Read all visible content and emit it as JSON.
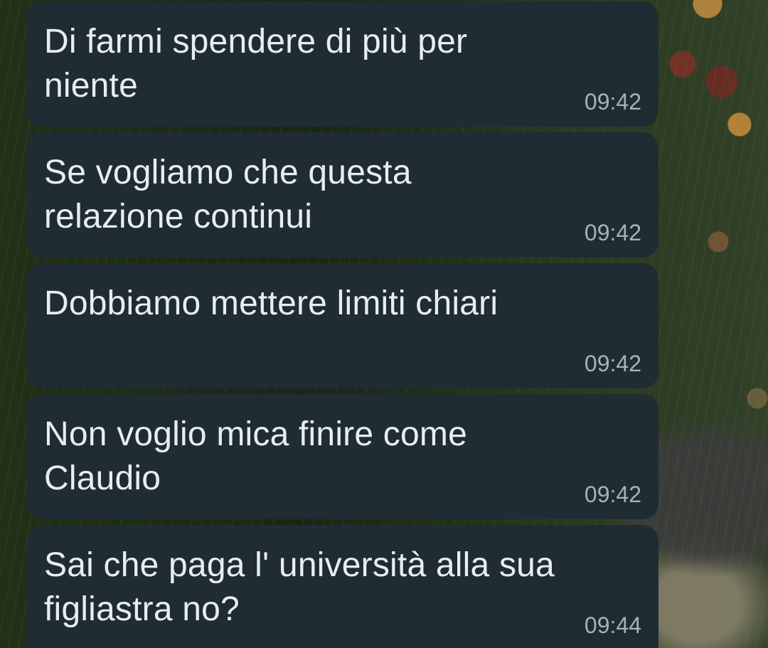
{
  "messages": [
    {
      "text": "Di farmi spendere di più per niente",
      "time": "09:42"
    },
    {
      "text": "Se vogliamo che questa relazione continui",
      "time": "09:42"
    },
    {
      "text": "Dobbiamo mettere limiti chiari",
      "time": "09:42"
    },
    {
      "text": "Non voglio mica finire come Claudio",
      "time": "09:42"
    },
    {
      "text": "Sai che paga l' università alla sua figliastra no?",
      "time": "09:44"
    }
  ]
}
